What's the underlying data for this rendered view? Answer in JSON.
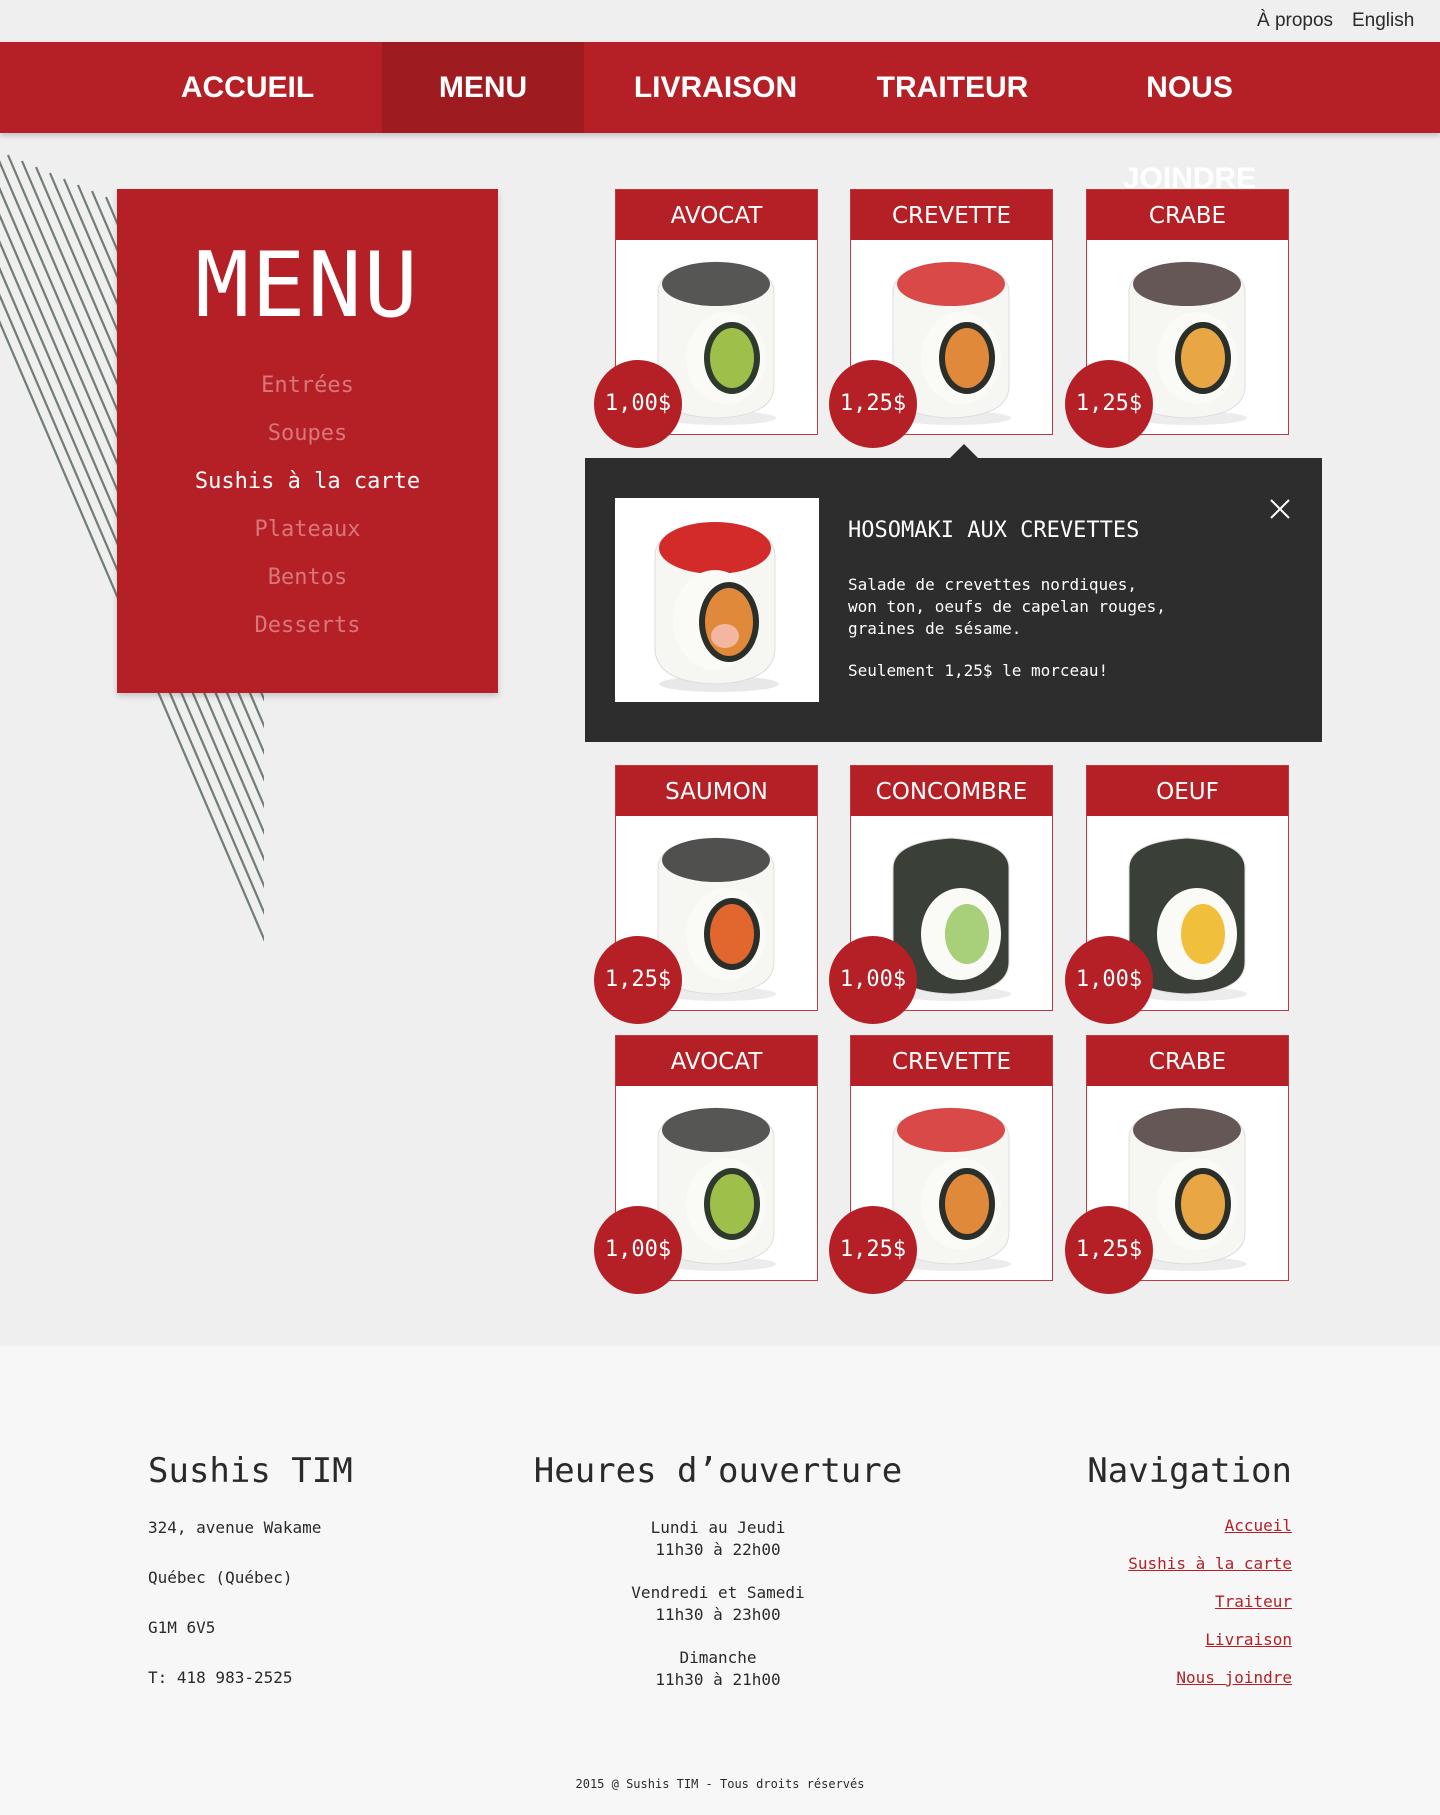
{
  "topbar": {
    "about": "À propos",
    "english": "English"
  },
  "nav": [
    "ACCUEIL",
    "MENU",
    "LIVRAISON",
    "TRAITEUR",
    "NOUS JOINDRE"
  ],
  "menu": {
    "title": "MENU",
    "categories": [
      "Entrées",
      "Soupes",
      "Sushis à la carte",
      "Plateaux",
      "Bentos",
      "Desserts"
    ],
    "active": "Sushis à la carte"
  },
  "cards": [
    {
      "name": "AVOCAT",
      "price": "1,00$",
      "filling": "avocado"
    },
    {
      "name": "CREVETTE",
      "price": "1,25$",
      "filling": "shrimp"
    },
    {
      "name": "CRABE",
      "price": "1,25$",
      "filling": "crab"
    },
    {
      "name": "SAUMON",
      "price": "1,25$",
      "filling": "salmon"
    },
    {
      "name": "CONCOMBRE",
      "price": "1,00$",
      "filling": "cucumber"
    },
    {
      "name": "OEUF",
      "price": "1,00$",
      "filling": "egg"
    },
    {
      "name": "AVOCAT",
      "price": "1,00$",
      "filling": "avocado"
    },
    {
      "name": "CREVETTE",
      "price": "1,25$",
      "filling": "shrimp"
    },
    {
      "name": "CRABE",
      "price": "1,25$",
      "filling": "crab"
    }
  ],
  "popup": {
    "title": "HOSOMAKI AUX CREVETTES",
    "description": "Salade de crevettes nordiques,\nwon ton, oeufs de capelan rouges,\ngraines de sésame.",
    "price_text": "Seulement 1,25$ le morceau!",
    "close_icon": "close-icon"
  },
  "footer": {
    "brand": "Sushis TIM",
    "address": [
      "324, avenue Wakame",
      "Québec (Québec)",
      "G1M 6V5",
      "T: 418 983-2525"
    ],
    "hours_heading": "Heures d’ouverture",
    "hours": [
      {
        "days": "Lundi au Jeudi",
        "time": "11h30 à 22h00"
      },
      {
        "days": "Vendredi et Samedi",
        "time": "11h30 à 23h00"
      },
      {
        "days": "Dimanche",
        "time": "11h30 à 21h00"
      }
    ],
    "nav_heading": "Navigation",
    "nav_links": [
      "Accueil",
      "Sushis à la carte",
      "Traiteur",
      "Livraison",
      "Nous joindre"
    ],
    "copyright": "2015 @ Sushis TIM - Tous droits réservés"
  },
  "colors": {
    "brand_red": "#b42026",
    "active_red": "#9e1b20",
    "popup_bg": "#2d2d2d",
    "stripe": "#6f7d73"
  }
}
